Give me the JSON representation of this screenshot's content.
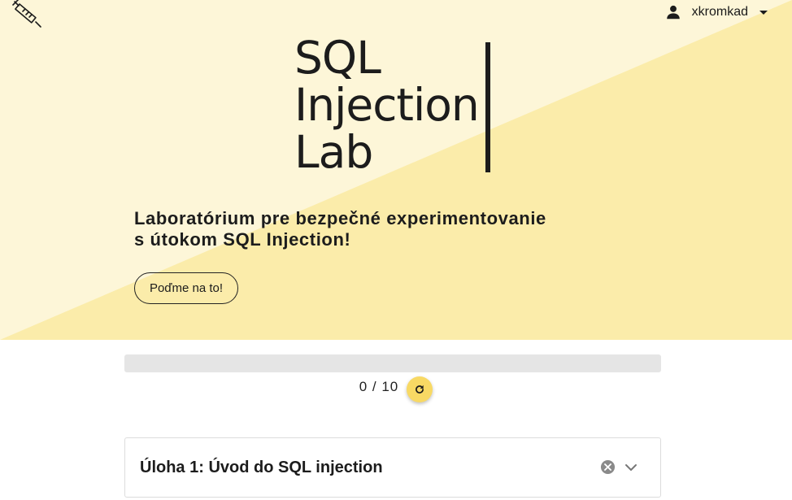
{
  "colors": {
    "hero_light": "#fdf6d8",
    "hero_dark": "#fbecaa",
    "accent": "#f8d964",
    "text": "#1c1c1c"
  },
  "header": {
    "logo_icon": "syringe-icon",
    "user": {
      "icon": "person-icon",
      "username": "xkromkad",
      "dropdown_icon": "caret-down-icon"
    }
  },
  "hero": {
    "title_lines": [
      "SQL",
      "Injection",
      "Lab"
    ],
    "tagline_line1": "Laboratórium pre bezpečné experimentovanie",
    "tagline_line2": "s útokom SQL Injection!",
    "cta_label": "Poďme na to!"
  },
  "progress": {
    "completed": 0,
    "total": 10,
    "text": "0 / 10",
    "reset_icon": "refresh-icon"
  },
  "tasks": [
    {
      "title": "Úloha 1: Úvod do SQL injection",
      "status_icon": "cancel-circle-icon",
      "expand_icon": "chevron-down-icon"
    }
  ]
}
